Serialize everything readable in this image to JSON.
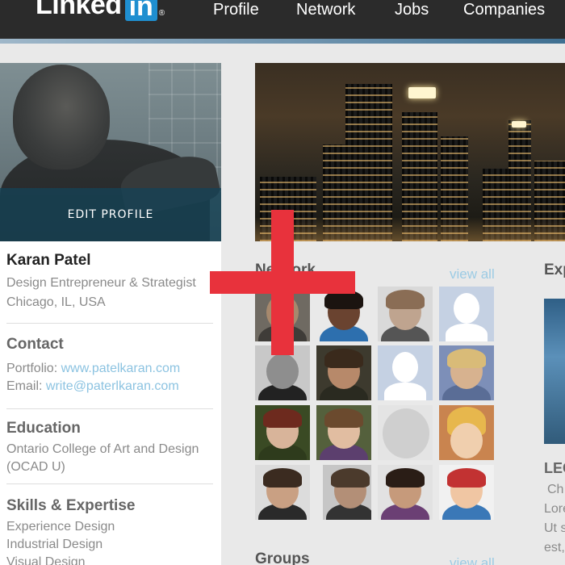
{
  "header": {
    "logo_text": "Linked",
    "logo_box": "in",
    "logo_mark": "®",
    "nav": [
      {
        "label": "Profile"
      },
      {
        "label": "Network"
      },
      {
        "label": "Jobs"
      },
      {
        "label": "Companies"
      }
    ]
  },
  "profile": {
    "edit_label": "EDIT  PROFILE",
    "name": "Karan Patel",
    "headline": "Design Entrepreneur & Strategist",
    "location": "Chicago, IL, USA",
    "contact": {
      "title": "Contact",
      "portfolio_label": "Portfolio: ",
      "portfolio_value": "www.patelkaran.com",
      "email_label": "Email: ",
      "email_value": "write@paterlkaran.com"
    },
    "education": {
      "title": "Education",
      "school": "Ontario College of Art and Design",
      "abbr": "(OCAD U)"
    },
    "skills": {
      "title": "Skills & Expertise",
      "items": [
        "Experience Design",
        "Industrial Design",
        "Visual Design"
      ]
    }
  },
  "network": {
    "title": "Network",
    "view_all": "view all"
  },
  "experience": {
    "title": "Exp",
    "name": "LEG",
    "lines": [
      "Ch",
      "Lore",
      "Ut s",
      "est,"
    ]
  },
  "groups": {
    "title": "Groups",
    "view_all": "view all"
  },
  "colors": {
    "accent_link": "#8cc3e1",
    "logo_blue": "#1f8fd0",
    "overlay_red": "#e8323c",
    "topbar": "#2b2b2b"
  }
}
